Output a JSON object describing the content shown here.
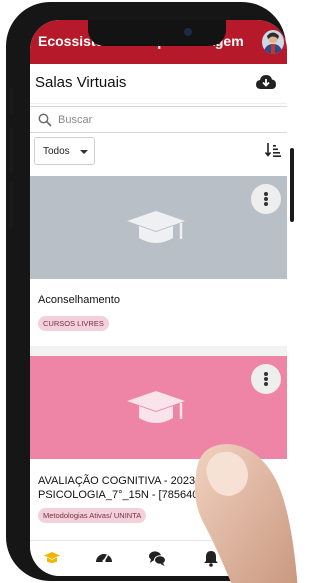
{
  "app": {
    "title": "Ecossistema de Aprendizagem"
  },
  "header": {
    "page_title": "Salas Virtuais",
    "cloud_icon": "cloud-download-icon"
  },
  "search": {
    "placeholder": "Buscar",
    "icon": "search-icon"
  },
  "filter": {
    "selected": "Todos",
    "sort_icon": "sort-icon"
  },
  "cards": [
    {
      "name": "Aconselhamento",
      "tag": "CURSOS LIVRES",
      "banner_color": "#b9bfc6"
    },
    {
      "name": "AVALIAÇÃO COGNITIVA - 2023 - PSICOLOGIA_7°_15N - [785640]",
      "tag": "Metodologias Ativas/ UNINTA",
      "banner_color": "#ee85a6"
    }
  ],
  "bottom_nav": [
    "graduation-cap-icon",
    "speedometer-icon",
    "chat-icon",
    "bell-icon"
  ],
  "colors": {
    "brand": "#b6192a",
    "active_nav": "#f2b600",
    "nav_icon": "#222222"
  }
}
